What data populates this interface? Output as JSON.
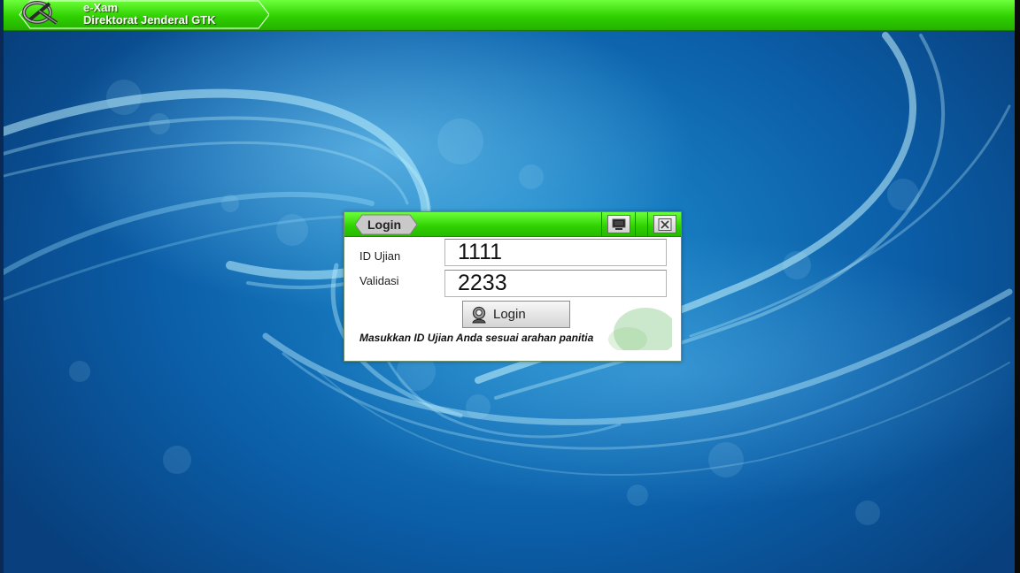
{
  "app": {
    "name": "e-Xam",
    "subtitle": "Direktorat Jenderal GTK"
  },
  "login_dialog": {
    "title": "Login",
    "id_label": "ID Ujian",
    "id_value": "1111",
    "validation_label": "Validasi",
    "validation_value": "2233",
    "login_button_label": "Login",
    "hint": "Masukkan ID Ujian Anda sesuai arahan panitia"
  },
  "icons": {
    "app_logo": "exam-logo-icon",
    "minimize": "monitor-icon",
    "close": "close-icon",
    "login": "user-icon"
  },
  "colors": {
    "topbar": "#2fd000",
    "background": "#0b5ea8"
  }
}
